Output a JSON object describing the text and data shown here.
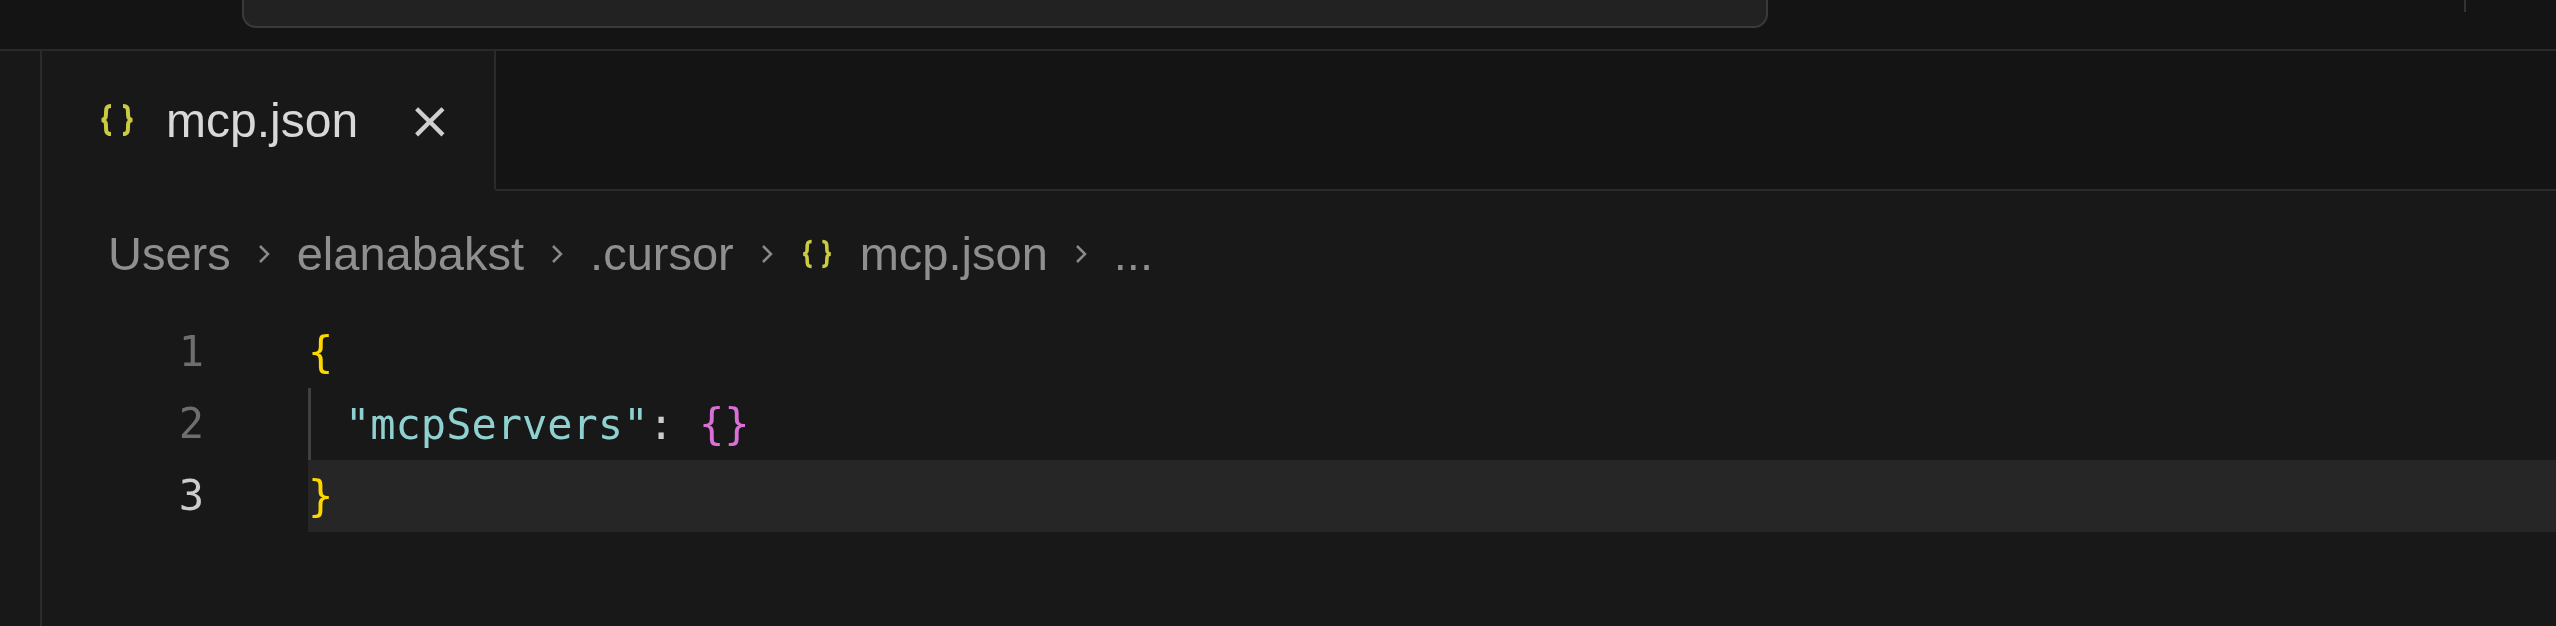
{
  "tabs": [
    {
      "label": "mcp.json",
      "selected": true,
      "close": "×"
    }
  ],
  "breadcrumbs": [
    {
      "label": "Users",
      "kind": "folder"
    },
    {
      "label": "elanabakst",
      "kind": "folder"
    },
    {
      "label": ".cursor",
      "kind": "folder"
    },
    {
      "label": "mcp.json",
      "kind": "file"
    },
    {
      "label": "...",
      "kind": "more"
    }
  ],
  "editor": {
    "lines": [
      {
        "number": "1",
        "current": false,
        "indent": false,
        "tokens": [
          {
            "text": "{",
            "kind": "brace"
          }
        ]
      },
      {
        "number": "2",
        "current": false,
        "indent": true,
        "tokens": [
          {
            "text": "\"mcpServers\"",
            "kind": "key"
          },
          {
            "text": ": ",
            "kind": "punct"
          },
          {
            "text": "{}",
            "kind": "brace2"
          }
        ]
      },
      {
        "number": "3",
        "current": true,
        "indent": false,
        "tokens": [
          {
            "text": "}",
            "kind": "brace"
          }
        ]
      }
    ]
  }
}
